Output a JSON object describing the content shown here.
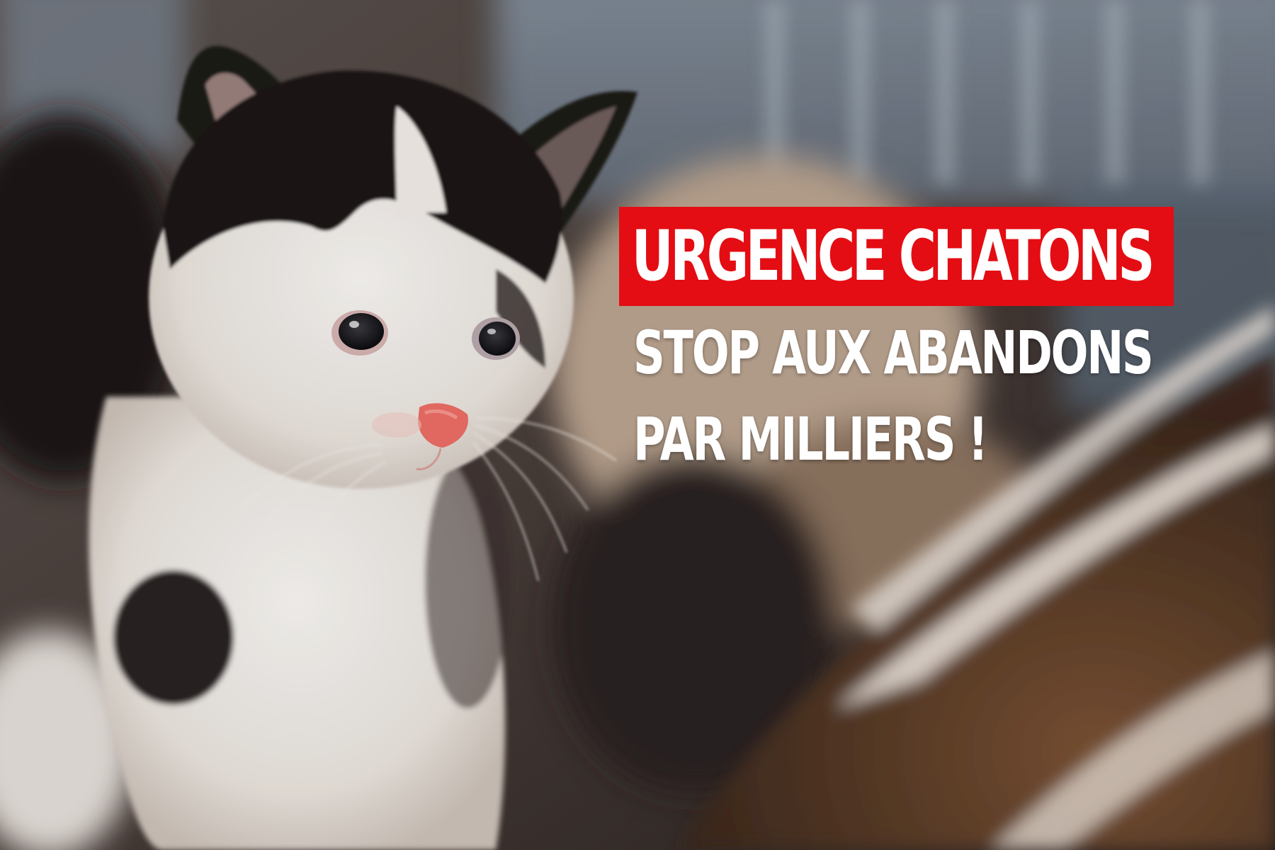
{
  "banner": {
    "title": "URGENCE CHATONS",
    "subtitle_line1": "STOP AUX ABANDONS",
    "subtitle_line2": "PAR MILLIERS !"
  },
  "colors": {
    "title_background": "#e30d13",
    "text": "#ffffff"
  },
  "photo": {
    "subject": "kitten-photo"
  }
}
